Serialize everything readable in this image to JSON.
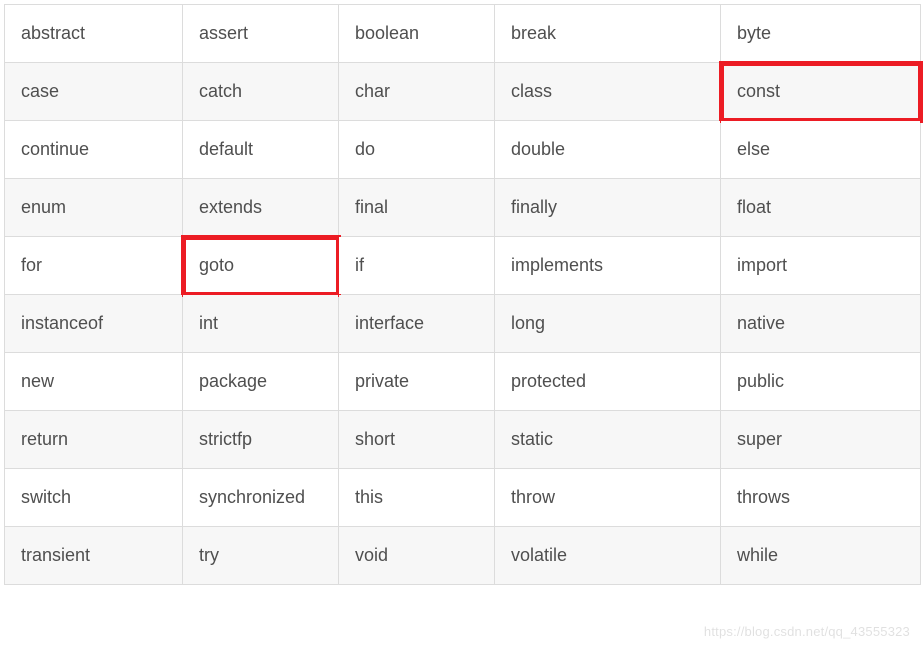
{
  "table": {
    "rows": [
      [
        "abstract",
        "assert",
        "boolean",
        "break",
        "byte"
      ],
      [
        "case",
        "catch",
        "char",
        "class",
        "const"
      ],
      [
        "continue",
        "default",
        "do",
        "double",
        "else"
      ],
      [
        "enum",
        "extends",
        "final",
        "finally",
        "float"
      ],
      [
        "for",
        "goto",
        "if",
        "implements",
        "import"
      ],
      [
        "instanceof",
        "int",
        "interface",
        "long",
        "native"
      ],
      [
        "new",
        "package",
        "private",
        "protected",
        "public"
      ],
      [
        "return",
        "strictfp",
        "short",
        "static",
        "super"
      ],
      [
        "switch",
        "synchronized",
        "this",
        "throw",
        "throws"
      ],
      [
        "transient",
        "try",
        "void",
        "volatile",
        "while"
      ]
    ],
    "highlighted": [
      "const",
      "goto"
    ]
  },
  "watermark": "https://blog.csdn.net/qq_43555323"
}
